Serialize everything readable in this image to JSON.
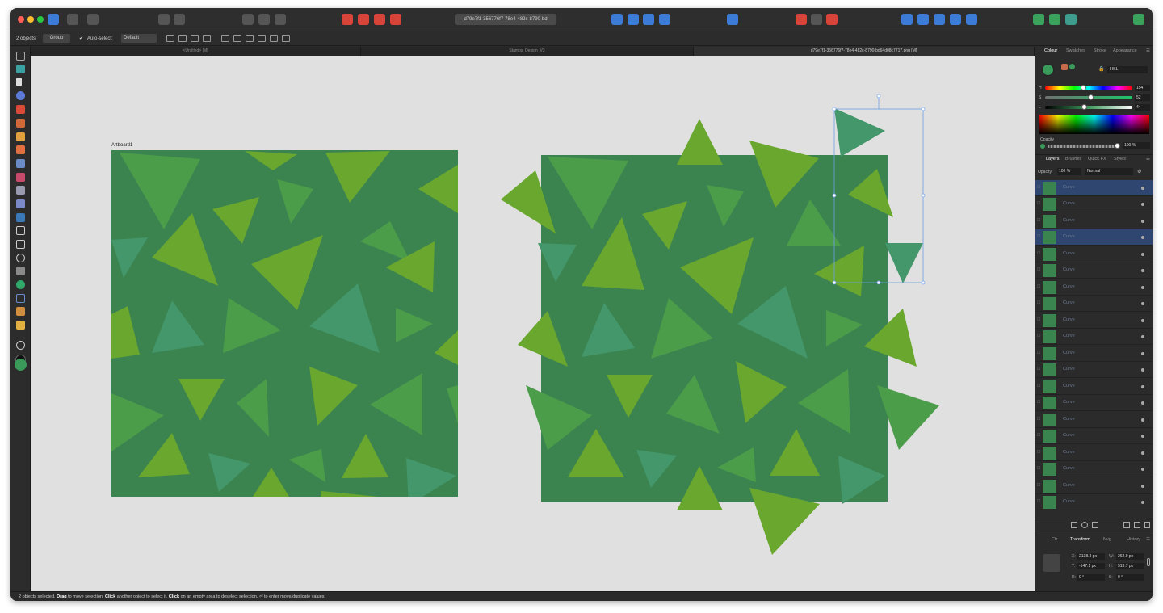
{
  "app": {
    "document_title": "d79e7f1-356776f7-78e4-482c-8790-bd",
    "colors": {
      "canvas": "#e0e0e0",
      "pattern_bg": "#3b8450",
      "tri_light": "#6aa72e",
      "tri_mid": "#4b9d4a",
      "tri_teal": "#43976a",
      "selection": "#6d9ee8",
      "accent_blue": "#3c7bd6"
    }
  },
  "context_toolbar": {
    "selection_count": "2 objects",
    "group_label": "Group",
    "auto_select_label": "Auto-select:",
    "auto_select_value": "Default"
  },
  "tabs": [
    {
      "label": "<Untitled> [M]",
      "active": false
    },
    {
      "label": "Stamps_Design_V3",
      "active": false
    },
    {
      "label": "d79e7f1-356776f7-78e4-482c-8790-bd64d08c7717.png [M]",
      "active": true
    }
  ],
  "canvas": {
    "artboard_label": "Artboard1"
  },
  "colour_panel": {
    "tabs": [
      "Colour",
      "Swatches",
      "Stroke",
      "Appearance"
    ],
    "model": "HSL",
    "h": "154",
    "s": "52",
    "l": "44",
    "h_fraction": 0.43,
    "s_fraction": 0.52,
    "l_fraction": 0.44,
    "opacity_label": "Opacity",
    "opacity_value": "100 %"
  },
  "layers_panel": {
    "tabs": [
      "Layers",
      "Brushes",
      "Quick FX",
      "Styles"
    ],
    "opacity_label": "Opacity:",
    "opacity_value": "100 %",
    "blend_mode": "Normal",
    "rows": [
      {
        "name": "Curve",
        "selected": true
      },
      {
        "name": "Curve",
        "selected": false
      },
      {
        "name": "Curve",
        "selected": false
      },
      {
        "name": "Curve",
        "selected": true
      },
      {
        "name": "Curve",
        "selected": false
      },
      {
        "name": "Curve",
        "selected": false
      },
      {
        "name": "Curve",
        "selected": false
      },
      {
        "name": "Curve",
        "selected": false
      },
      {
        "name": "Curve",
        "selected": false
      },
      {
        "name": "Curve",
        "selected": false
      },
      {
        "name": "Curve",
        "selected": false
      },
      {
        "name": "Curve",
        "selected": false
      },
      {
        "name": "Curve",
        "selected": false
      },
      {
        "name": "Curve",
        "selected": false
      },
      {
        "name": "Curve",
        "selected": false
      },
      {
        "name": "Curve",
        "selected": false
      },
      {
        "name": "Curve",
        "selected": false
      },
      {
        "name": "Curve",
        "selected": false
      },
      {
        "name": "Curve",
        "selected": false
      },
      {
        "name": "Curve",
        "selected": false
      }
    ]
  },
  "transform_panel": {
    "tabs": [
      "Ctr",
      "Transform",
      "Nvg",
      "History"
    ],
    "x": "2138.3 px",
    "y": "-147.1 px",
    "w": "262.9 px",
    "h": "513.7 px",
    "r": "0 °",
    "s": "0 °"
  },
  "status": {
    "p1": "2 objects selected. ",
    "b1": "Drag",
    "p2": " to move selection. ",
    "b2": "Click",
    "p3": " another object to select it. ",
    "b3": "Click",
    "p4": " on an empty area to deselect selection. ⏎ to enter move/duplicate values."
  }
}
